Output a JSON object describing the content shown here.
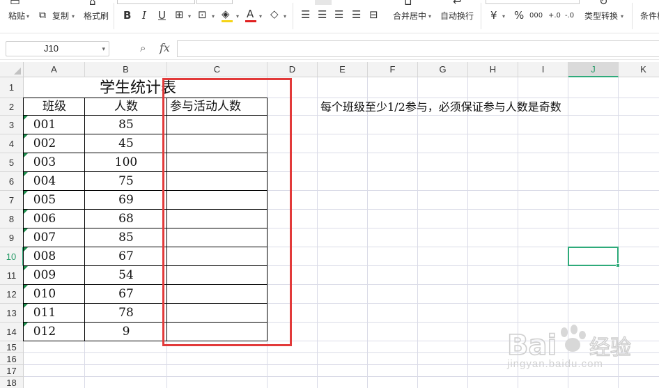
{
  "ribbon": {
    "paste_label": "粘贴",
    "copy_label": "复制",
    "format_painter_label": "格式刷",
    "merge_center_label": "合并居中",
    "wrap_text_label": "自动换行",
    "currency_icon": "¥",
    "percent_icon": "%",
    "thousands_icon": "000",
    "inc_decimal_icon": "+.0",
    "dec_decimal_icon": "-.0",
    "type_convert_label": "类型转换",
    "conditional_label": "条件格",
    "bold_icon": "B",
    "italic_icon": "I",
    "underline_icon": "U",
    "font_color_icon": "A",
    "font_color": "#e02020",
    "fill_color": "#f5d417"
  },
  "formula_bar": {
    "name_box_value": "J10",
    "zoom_icon": "⌕",
    "fx_label": "fx",
    "formula_value": ""
  },
  "columns": [
    "A",
    "B",
    "C",
    "D",
    "E",
    "F",
    "G",
    "H",
    "I",
    "J",
    "K"
  ],
  "active_column": "J",
  "rows": [
    "1",
    "2",
    "3",
    "4",
    "5",
    "6",
    "7",
    "8",
    "9",
    "10",
    "11",
    "12",
    "13",
    "14",
    "15",
    "16",
    "17",
    "18"
  ],
  "active_row": "10",
  "sheet": {
    "title": "学生统计表",
    "headers": [
      "班级",
      "人数",
      "参与活动人数"
    ],
    "records": [
      {
        "class": "001",
        "count": "85"
      },
      {
        "class": "002",
        "count": "45"
      },
      {
        "class": "003",
        "count": "100"
      },
      {
        "class": "004",
        "count": "75"
      },
      {
        "class": "005",
        "count": "69"
      },
      {
        "class": "006",
        "count": "68"
      },
      {
        "class": "007",
        "count": "85"
      },
      {
        "class": "008",
        "count": "67"
      },
      {
        "class": "009",
        "count": "54"
      },
      {
        "class": "010",
        "count": "67"
      },
      {
        "class": "011",
        "count": "78"
      },
      {
        "class": "012",
        "count": "9"
      }
    ],
    "note": "每个班级至少1/2参与，必须保证参与人数是奇数"
  },
  "colors": {
    "active_green": "#2eaa7a",
    "highlight_red": "#e23a3a",
    "gridline": "#dadbe7"
  },
  "watermark": {
    "brand": "Bai",
    "brand_suffix": "经验",
    "sub": "jingyan.baidu.com"
  }
}
